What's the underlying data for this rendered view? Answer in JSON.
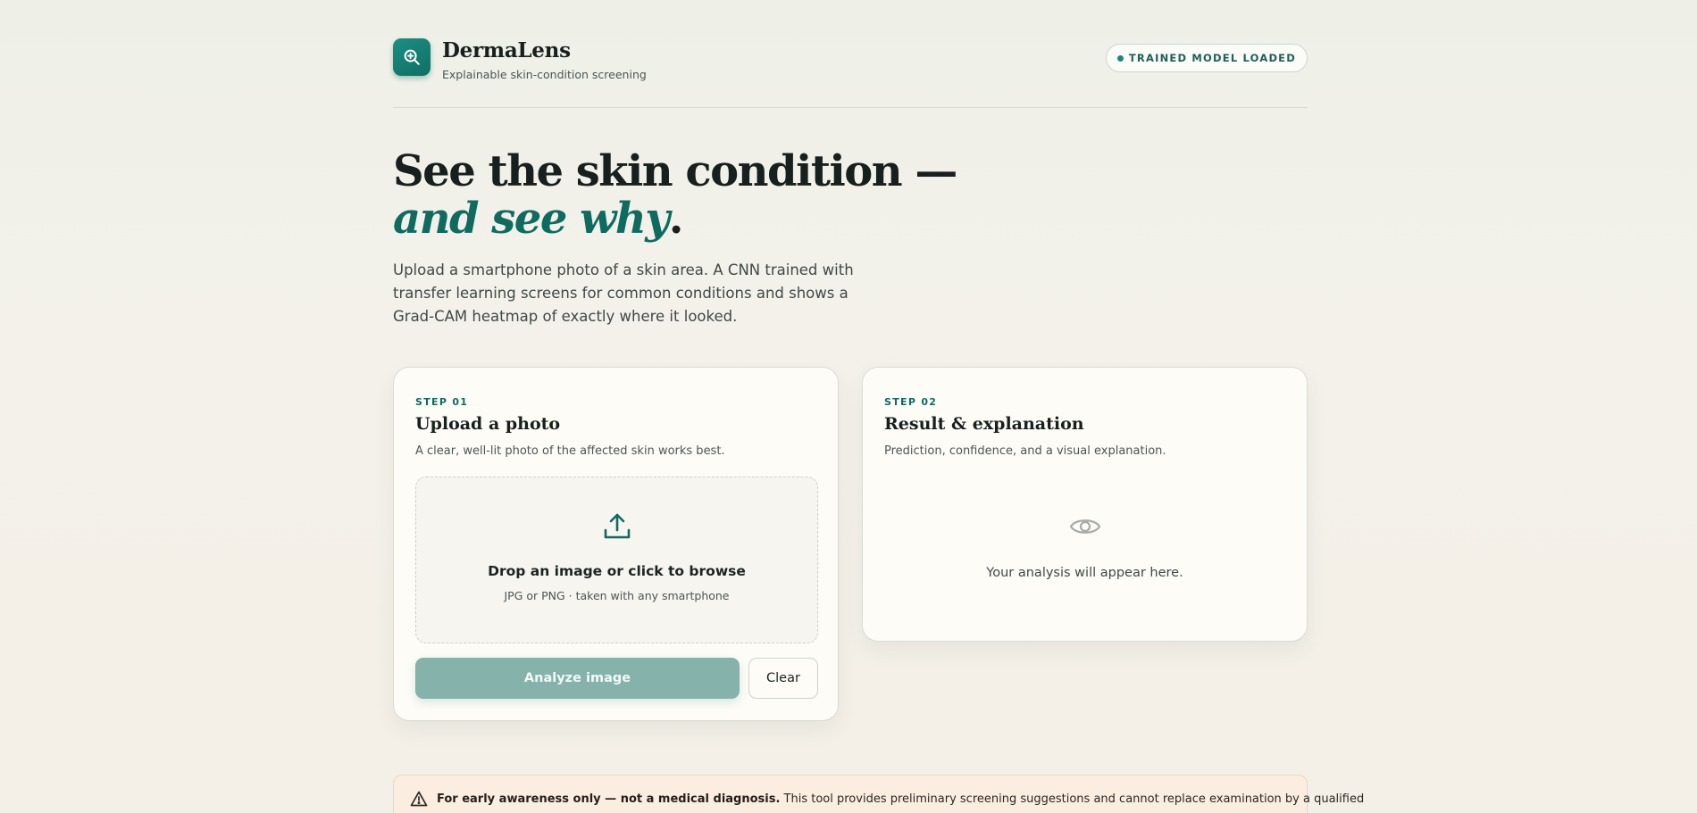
{
  "brand": {
    "name": "DermaLens",
    "tagline": "Explainable skin-condition screening",
    "logo_icon": "zoom-in-icon",
    "accent_color": "#0f6b60"
  },
  "status": {
    "label": "TRAINED MODEL LOADED",
    "dot_color": "#17887b"
  },
  "hero": {
    "title_main": "See the skin condition — ",
    "title_accent": "and see why",
    "title_end": ".",
    "description": "Upload a smartphone photo of a skin area. A CNN trained with transfer learning screens for common conditions and shows a Grad-CAM heatmap of exactly where it looked."
  },
  "upload_card": {
    "step": "STEP 01",
    "title": "Upload a photo",
    "subtitle": "A clear, well-lit photo of the affected skin works best.",
    "dropzone": {
      "icon": "upload-icon",
      "title": "Drop an image or click to browse",
      "subtitle": "JPG or PNG · taken with any smartphone"
    },
    "analyze_label": "Analyze image",
    "clear_label": "Clear"
  },
  "result_card": {
    "step": "STEP 02",
    "title": "Result & explanation",
    "subtitle": "Prediction, confidence, and a visual explanation.",
    "icon": "eye-icon",
    "placeholder": "Your analysis will appear here."
  },
  "disclaimer": {
    "icon": "warning-icon",
    "bold": "For early awareness only — not a medical diagnosis.",
    "text": " This tool provides preliminary screening suggestions and cannot replace examination by a qualified"
  }
}
